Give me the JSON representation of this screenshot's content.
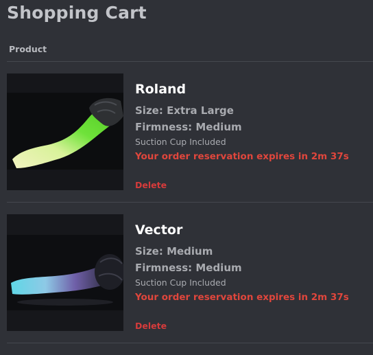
{
  "page": {
    "title": "Shopping Cart",
    "column_header": "Product"
  },
  "items": [
    {
      "name": "Roland",
      "size": "Size: Extra Large",
      "firmness": "Firmness: Medium",
      "option": "Suction Cup Included",
      "reservation": "Your order reservation expires in 2m 37s",
      "delete_label": "Delete",
      "colors": {
        "tip": "#f2f3c0",
        "shaft": "#6fe23a",
        "base": "#2e3033"
      }
    },
    {
      "name": "Vector",
      "size": "Size: Medium",
      "firmness": "Firmness: Medium",
      "option": "Suction Cup Included",
      "reservation": "Your order reservation expires in 2m 37s",
      "delete_label": "Delete",
      "colors": {
        "tip": "#5fd7e6",
        "shaft": "#6f5fa8",
        "base": "#1e1f26"
      }
    }
  ],
  "theme": {
    "background": "#2f3137",
    "accent_red": "#e0463c",
    "name_color": "#ffffff"
  }
}
